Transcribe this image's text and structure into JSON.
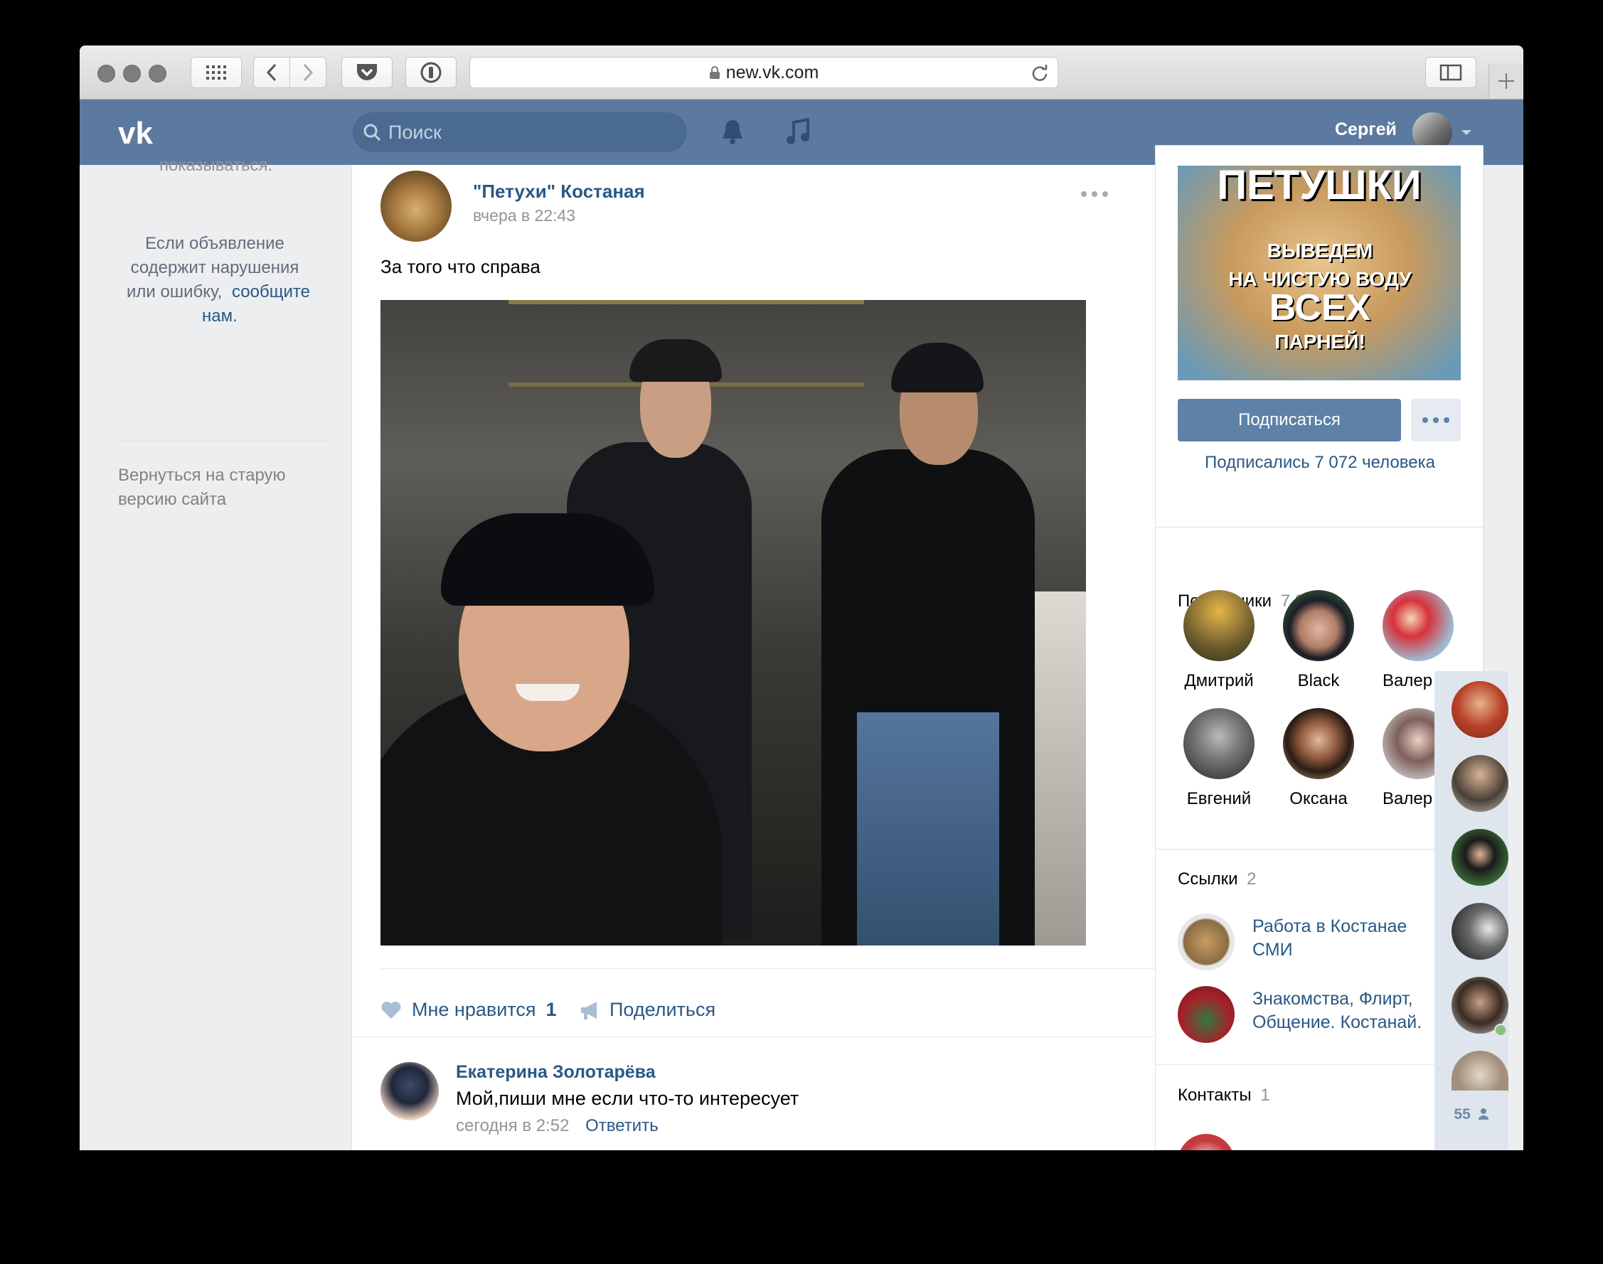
{
  "browser": {
    "url": "new.vk.com"
  },
  "header": {
    "search_placeholder": "Поиск",
    "user_name": "Сергей"
  },
  "left": {
    "top_cut": "показываться.",
    "ad_text_1": "Если объявление",
    "ad_text_2": "содержит нарушения",
    "ad_text_3": "или ошибку,",
    "ad_link_1": "сообщите",
    "ad_link_2": "нам.",
    "old_version_1": "Вернуться на старую",
    "old_version_2": "версию сайта"
  },
  "post": {
    "group_name": "\"Петухи\" Костаная",
    "date": "вчера в 22:43",
    "text": "За того что справа",
    "like_label": "Мне нравится",
    "like_count": "1",
    "share_label": "Поделиться",
    "comment": {
      "author": "Екатерина Золотарёва",
      "text": "Мой,пиши мне если что-то интересует",
      "date": "сегодня в 2:52",
      "reply": "Ответить"
    }
  },
  "group_panel": {
    "subscribe": "Подписаться",
    "subscribers_text": "Подписались 7 072 человека"
  },
  "subscribers": {
    "title": "Подписчики",
    "count": "7 072",
    "items": [
      {
        "name": "Дмитрий"
      },
      {
        "name": "Black"
      },
      {
        "name": "Валер"
      },
      {
        "name": "Евгений"
      },
      {
        "name": "Оксана"
      },
      {
        "name": "Валер"
      }
    ]
  },
  "links": {
    "title": "Ссылки",
    "count": "2",
    "items": [
      {
        "line1": "Работа в Костанае",
        "line2": "СМИ"
      },
      {
        "line1": "Знакомства, Флирт,",
        "line2": "Общение. Костанай."
      }
    ]
  },
  "contacts": {
    "title": "Контакты",
    "count": "1"
  },
  "friends_bar": {
    "online_count": "55"
  },
  "colors": {
    "vk_header": "#5c7a9f",
    "link": "#2a5885",
    "button": "#5e81a8",
    "page_bg": "#edeef0"
  }
}
